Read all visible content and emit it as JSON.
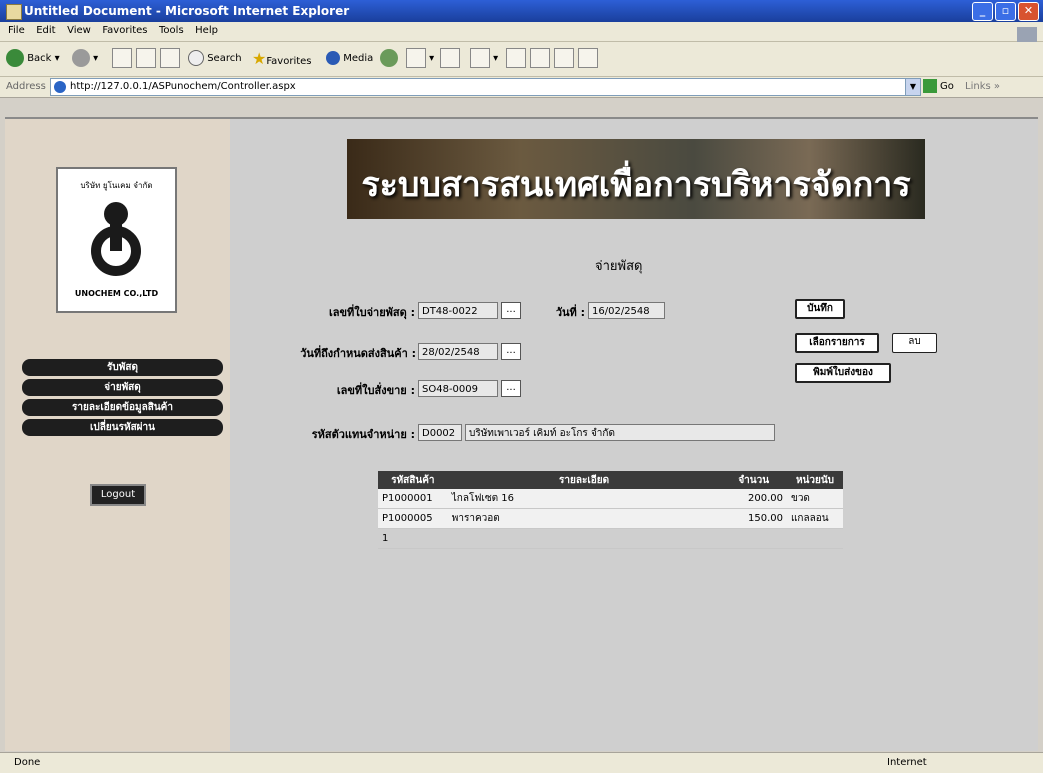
{
  "window": {
    "title": "Untitled Document - Microsoft Internet Explorer"
  },
  "menu": [
    "File",
    "Edit",
    "View",
    "Favorites",
    "Tools",
    "Help"
  ],
  "toolbar": {
    "back": "Back",
    "search": "Search",
    "favorites": "Favorites",
    "media": "Media"
  },
  "address": {
    "label": "Address",
    "url": "http://127.0.0.1/ASPunochem/Controller.aspx",
    "go": "Go",
    "links": "Links"
  },
  "logo": {
    "top": "บริษัท ยูโนเคม จำกัด",
    "bottom": "UNOCHEM CO.,LTD"
  },
  "nav": [
    "รับพัสดุ",
    "จ่ายพัสดุ",
    "รายละเอียดข้อมูลสินค้า",
    "เปลี่ยนรหัสผ่าน"
  ],
  "logout": "Logout",
  "banner": "ระบบสารสนเทศเพื่อการบริหารจัดการ",
  "page_title": "จ่ายพัสดุ",
  "form": {
    "doc_no_label": "เลขที่ใบจ่ายพัสดุ :",
    "doc_no": "DT48-0022",
    "date_label": "วันที่ :",
    "date": "16/02/2548",
    "due_label": "วันที่ถึงกำหนดส่งสินค้า :",
    "due": "28/02/2548",
    "so_label": "เลขที่ใบสั่งขาย :",
    "so": "SO48-0009",
    "rep_label": "รหัสตัวแทนจำหน่าย :",
    "rep_code": "D0002",
    "rep_name": "บริษัทเพาเวอร์ เคิมท์ อะโกร จำกัด",
    "lookup": "..."
  },
  "buttons": {
    "save": "บันทึก",
    "select": "เลือกรายการ",
    "delete": "ลบ",
    "print": "พิมพ์ใบส่งของ"
  },
  "table": {
    "headers": [
      "รหัสสินค้า",
      "รายละเอียด",
      "จำนวน",
      "หน่วยนับ"
    ],
    "rows": [
      [
        "P1000001",
        "ไกลโฟเซต 16",
        "200.00",
        "ขวด"
      ],
      [
        "P1000005",
        "พาราควอต",
        "150.00",
        "แกลลอน"
      ]
    ],
    "pager": "1"
  },
  "status": {
    "left": "Done",
    "zone": "Internet"
  }
}
